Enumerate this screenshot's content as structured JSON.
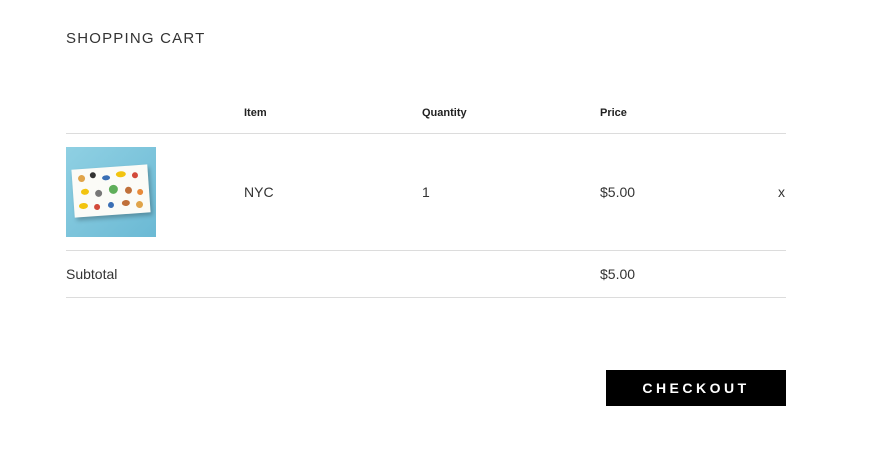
{
  "cart": {
    "title": "SHOPPING CART",
    "headers": {
      "item": "Item",
      "quantity": "Quantity",
      "price": "Price"
    },
    "items": [
      {
        "name": "NYC",
        "quantity": "1",
        "price": "$5.00",
        "remove_label": "x"
      }
    ],
    "subtotal_label": "Subtotal",
    "subtotal_value": "$5.00",
    "checkout_label": "CHECKOUT"
  },
  "colors": {
    "button_bg": "#000000",
    "divider": "#dcdcdc",
    "thumb_bg": "#8fd0e3"
  }
}
